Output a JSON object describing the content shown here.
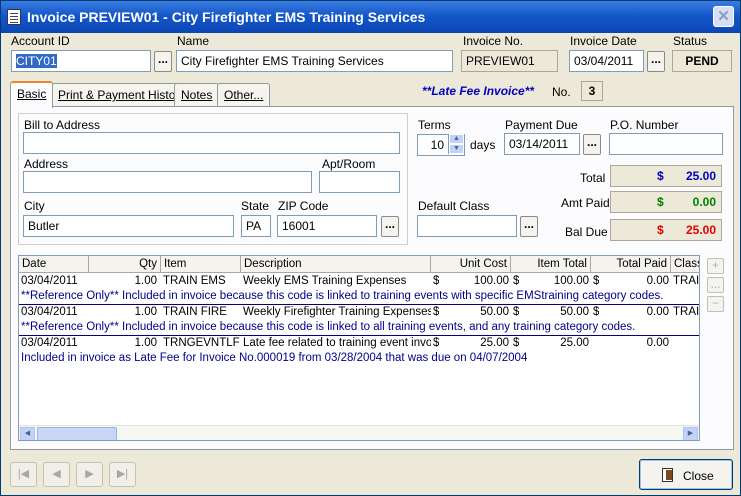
{
  "window": {
    "title": "Invoice  PREVIEW01 - City Firefighter EMS Training Services",
    "close_glyph": "✕"
  },
  "header": {
    "account_id_label": "Account ID",
    "account_id_value": "CITY01",
    "name_label": "Name",
    "name_value": "City Firefighter EMS Training Services",
    "invoice_no_label": "Invoice No.",
    "invoice_no_value": "PREVIEW01",
    "invoice_date_label": "Invoice Date",
    "invoice_date_value": "03/04/2011",
    "status_label": "Status",
    "status_value": "PEND",
    "browse_glyph": "..."
  },
  "tabs": [
    {
      "label": "Basic"
    },
    {
      "label": "Print & Payment History"
    },
    {
      "label": "Notes"
    },
    {
      "label": "Other..."
    }
  ],
  "late_fee_text": "**Late Fee Invoice**",
  "no_label": "No.",
  "no_value": "3",
  "address": {
    "bill_to_label": "Bill to Address",
    "bill_to_value": "",
    "address_label": "Address",
    "address_value": "",
    "apt_label": "Apt/Room",
    "apt_value": "",
    "city_label": "City",
    "city_value": "Butler",
    "state_label": "State",
    "state_value": "PA",
    "zip_label": "ZIP Code",
    "zip_value": "16001"
  },
  "terms": {
    "terms_label": "Terms",
    "terms_value": "10",
    "days_label": "days",
    "payment_due_label": "Payment Due",
    "payment_due_value": "03/14/2011",
    "po_label": "P.O. Number",
    "po_value": "",
    "default_class_label": "Default Class",
    "default_class_value": ""
  },
  "totals": {
    "total_label": "Total",
    "total_value": "25.00",
    "total_color": "#0000c0",
    "amt_paid_label": "Amt Paid",
    "amt_paid_value": "0.00",
    "amt_paid_color": "#008000",
    "bal_due_label": "Bal Due",
    "bal_due_value": "25.00",
    "bal_due_color": "#e00000",
    "currency": "$"
  },
  "grid": {
    "columns": [
      "Date",
      "Qty",
      "Item",
      "Description",
      "Unit Cost",
      "Item Total",
      "Total Paid",
      "Class"
    ],
    "rows": [
      {
        "date": "03/04/2011",
        "qty": "1.00",
        "item": "TRAIN EMS",
        "description": "Weekly EMS Training Expenses",
        "unit_cost": "100.00",
        "item_total": "100.00",
        "total_paid": "0.00",
        "class": "TRAIN",
        "note": "**Reference Only** Included in invoice because this code is linked to training events with specific EMStraining category codes."
      },
      {
        "date": "03/04/2011",
        "qty": "1.00",
        "item": "TRAIN FIRE",
        "description": "Weekly Firefighter Training Expenses",
        "unit_cost": "50.00",
        "item_total": "50.00",
        "total_paid": "0.00",
        "class": "TRAIN",
        "note": "**Reference Only** Included in invoice because this code is linked to all training events, and any training category codes."
      },
      {
        "date": "03/04/2011",
        "qty": "1.00",
        "item": "TRNGEVNTLF",
        "description": "Late fee related to training event invo...",
        "unit_cost": "25.00",
        "item_total": "25.00",
        "total_paid": "0.00",
        "class": "",
        "note": "Included in invoice as Late Fee for Invoice No.000019 from 03/28/2004 that was due on 04/07/2004"
      }
    ]
  },
  "side_buttons": [
    "+",
    "...",
    "−"
  ],
  "nav_buttons": [
    "|◀",
    "◀",
    "▶",
    "▶|"
  ],
  "close_button_label": "Close"
}
